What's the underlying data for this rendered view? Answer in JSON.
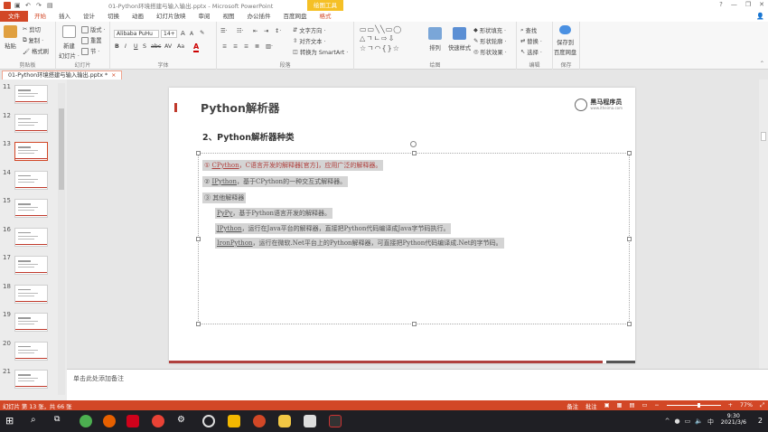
{
  "window": {
    "title": "01-Python环境搭建与输入输出.pptx - Microsoft PowerPoint",
    "context_tab": "绘图工具",
    "help": "?",
    "minimize": "—",
    "restore": "❐",
    "close": "✕"
  },
  "menu": {
    "file": "文件",
    "items": [
      "开始",
      "插入",
      "设计",
      "切换",
      "动画",
      "幻灯片放映",
      "审阅",
      "视图",
      "办公插件",
      "百度网盘",
      "格式"
    ],
    "active_index": 0
  },
  "ribbon": {
    "clipboard": {
      "paste": "粘贴",
      "cut": "剪切",
      "copy": "复制 ·",
      "format_painter": "格式刷",
      "label": "剪贴板"
    },
    "slides": {
      "new_slide": "新建",
      "new_slide2": "幻灯片 ·",
      "layout": "版式 ·",
      "reset": "重置",
      "section": "节 ·",
      "label": "幻灯片"
    },
    "font": {
      "font_name": "Alibaba PuHu",
      "font_size": "14+",
      "grow": "A",
      "shrink": "A",
      "bold": "B",
      "italic": "I",
      "underline": "U",
      "shadow": "S",
      "strike": "abc",
      "spacing": "AV",
      "case": "Aa",
      "color": "A",
      "label": "字体"
    },
    "paragraph": {
      "text_direction": "文字方向 ·",
      "align_text": "对齐文本 ·",
      "smartart": "转换为 SmartArt ·",
      "label": "段落"
    },
    "drawing": {
      "arrange": "排列",
      "quick_styles": "快速样式",
      "fill": "形状填充 ·",
      "outline": "形状轮廓 ·",
      "effects": "形状效果 ·",
      "label": "绘图"
    },
    "editing": {
      "find": "查找",
      "replace": "替换 ·",
      "select": "选择 ·",
      "label": "编辑"
    },
    "save": {
      "save_to": "保存到",
      "baidu": "百度网盘",
      "label": "保存"
    }
  },
  "doc_tab": {
    "name": "01-Python环境搭建与输入输出.pptx *",
    "close": "×"
  },
  "thumbnails": [
    {
      "num": "11",
      "selected": false
    },
    {
      "num": "12",
      "selected": false
    },
    {
      "num": "13",
      "selected": true
    },
    {
      "num": "14",
      "selected": false
    },
    {
      "num": "15",
      "selected": false
    },
    {
      "num": "16",
      "selected": false
    },
    {
      "num": "17",
      "selected": false
    },
    {
      "num": "18",
      "selected": false
    },
    {
      "num": "19",
      "selected": false
    },
    {
      "num": "20",
      "selected": false
    },
    {
      "num": "21",
      "selected": false
    }
  ],
  "slide": {
    "title": "Python解析器",
    "logo": "黑马程序员",
    "logo_sub": "www.itheima.com",
    "subtitle": "2、Python解析器种类",
    "lines": [
      {
        "prefix": "① ",
        "link": "CPython",
        "rest": "，C语言开发的解释器[官方]，应用广泛的解释器。"
      },
      {
        "prefix": "② ",
        "link": "IPython",
        "rest": "，基于CPython的一种交互式解释器。"
      },
      {
        "prefix": "③ ",
        "link": "",
        "rest": "其他解释器"
      },
      {
        "prefix": "",
        "link": "PyPy",
        "rest": "，基于Python语言开发的解释器。"
      },
      {
        "prefix": "",
        "link": "JPython",
        "rest": "，运行在Java平台的解释器，直接把Python代码编译成Java字节码执行。"
      },
      {
        "prefix": "",
        "link": "IronPython",
        "rest": "，运行在微软.Net平台上的Python解释器，可直接把Python代码编译成.Net的字节码。"
      }
    ]
  },
  "notes": {
    "placeholder": "单击此处添加备注"
  },
  "status": {
    "slide_info": "幻灯片 第 13 张，共 66 张",
    "notes_btn": "备注",
    "comments_btn": "批注",
    "zoom": "77%"
  },
  "taskbar": {
    "time": "9:30",
    "date": "2021/3/6",
    "lang": "中",
    "badge": "2"
  },
  "colors": {
    "accent": "#d24726",
    "slide_red": "#b0413e"
  }
}
